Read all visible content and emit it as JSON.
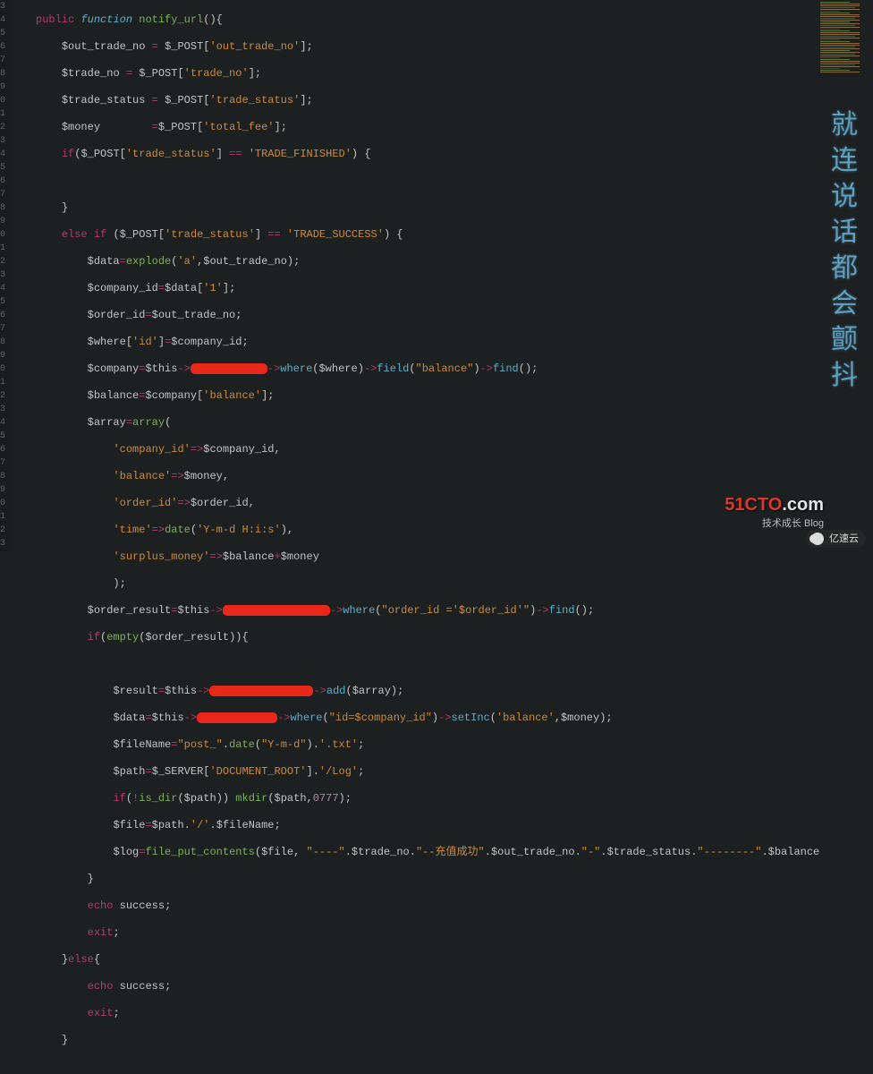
{
  "gutter_start_visible": "3",
  "side_caption": "就连说话都会颤抖",
  "logo_main": "51CTO",
  "logo_suffix": ".com",
  "logo_sub": "技术成长   Blog",
  "ys_badge": "亿速云",
  "code": {
    "l1": {
      "kw_public": "public",
      "kw_function": "function",
      "fname": "notify_url"
    },
    "l2": {
      "v": "$out_trade_no",
      "post": "$_POST",
      "key": "'out_trade_no'"
    },
    "l3": {
      "v": "$trade_no",
      "post": "$_POST",
      "key": "'trade_no'"
    },
    "l4": {
      "v": "$trade_status",
      "post": "$_POST",
      "key": "'trade_status'"
    },
    "l5": {
      "v": "$money",
      "post": "$_POST",
      "key": "'total_fee'"
    },
    "l6": {
      "if": "if",
      "post": "$_POST",
      "key": "'trade_status'",
      "eq": "==",
      "val": "'TRADE_FINISHED'"
    },
    "l8": {
      "else": "else",
      "if": "if",
      "post": "$_POST",
      "key": "'trade_status'",
      "eq": "==",
      "val": "'TRADE_SUCCESS'"
    },
    "l9": {
      "v": "$data",
      "fn": "explode",
      "a1": "'a'",
      "a2": "$out_trade_no"
    },
    "l10": {
      "v": "$company_id",
      "rhs": "$data",
      "idx": "'1'"
    },
    "l11": {
      "v": "$order_id",
      "rhs": "$out_trade_no"
    },
    "l12": {
      "v": "$where",
      "idx": "'id'",
      "rhs": "$company_id"
    },
    "l13": {
      "v": "$company",
      "this": "$this",
      "where": "where",
      "wherearg": "$where",
      "field": "field",
      "fieldarg": "\"balance\"",
      "find": "find"
    },
    "l14": {
      "v": "$balance",
      "rhs": "$company",
      "idx": "'balance'"
    },
    "l15": {
      "v": "$array",
      "fn": "array"
    },
    "l16": {
      "k": "'company_id'",
      "rv": "$company_id"
    },
    "l17": {
      "k": "'balance'",
      "rv": "$money"
    },
    "l18": {
      "k": "'order_id'",
      "rv": "$order_id"
    },
    "l19": {
      "k": "'time'",
      "fn": "date",
      "arg": "'Y-m-d H:i:s'"
    },
    "l20": {
      "k": "'surplus_money'",
      "rv1": "$balance",
      "rv2": "$money"
    },
    "l22": {
      "v": "$order_result",
      "this": "$this",
      "where": "where",
      "wherearg": "\"order_id ='$order_id'\"",
      "find": "find"
    },
    "l23": {
      "if": "if",
      "fn": "empty",
      "arg": "$order_result"
    },
    "l25": {
      "v": "$result",
      "this": "$this",
      "add": "add",
      "arg": "$array"
    },
    "l26": {
      "v": "$data",
      "this": "$this",
      "where": "where",
      "wherearg": "\"id=$company_id\"",
      "setinc": "setInc",
      "a1": "'balance'",
      "a2": "$money"
    },
    "l27": {
      "v": "$fileName",
      "s1": "\"post_\"",
      "fn": "date",
      "darg": "\"Y-m-d\"",
      "s2": "'.txt'"
    },
    "l28": {
      "v": "$path",
      "srv": "$_SERVER",
      "key": "'DOCUMENT_ROOT'",
      "s": "'/Log'"
    },
    "l29": {
      "if": "if",
      "isdir": "is_dir",
      "arg": "$path",
      "mkdir": "mkdir",
      "p": "$path",
      "mode": "0777"
    },
    "l30": {
      "v": "$file",
      "p": "$path",
      "sep": "'/'",
      "fn": "$fileName"
    },
    "l31": {
      "v": "$log",
      "fn": "file_put_contents",
      "f": "$file",
      "s1": "\"----\"",
      "t": "$trade_no",
      "s2": "\"--充值成功\"",
      "o": "$out_trade_no",
      "s3": "\"-\"",
      "ts": "$trade_status",
      "s4": "\"--------\"",
      "b": "$balance"
    },
    "l33": {
      "echo": "echo",
      "val": "success"
    },
    "l34": {
      "exit": "exit"
    },
    "l35": {
      "else": "else"
    },
    "l36": {
      "echo": "echo",
      "val": "success"
    },
    "l37": {
      "exit": "exit"
    }
  }
}
